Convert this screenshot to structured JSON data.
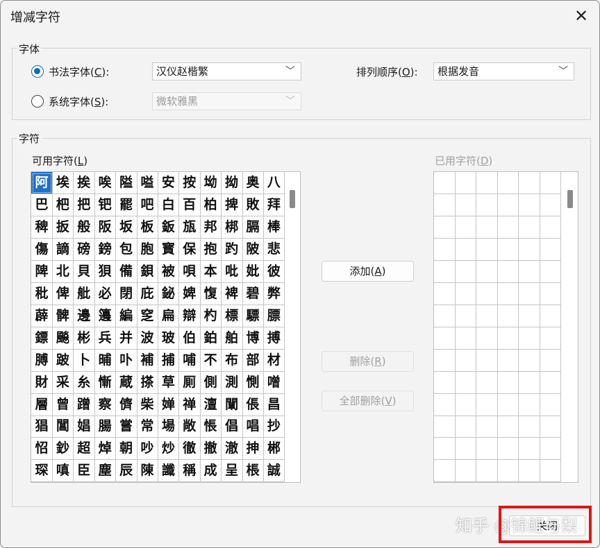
{
  "dialog": {
    "title": "增减字符",
    "close_glyph": "✕"
  },
  "font_group": {
    "label": "字体",
    "calligraphy": {
      "label": "书法字体(",
      "key": "C",
      "tail": "):",
      "selected": true,
      "value": "汉仪赵楷繁"
    },
    "system": {
      "label": "系统字体(",
      "key": "S",
      "tail": "):",
      "selected": false,
      "value": "微软雅黑"
    },
    "sort": {
      "label": "排列顺序(",
      "key": "O",
      "tail": "):",
      "value": "根据发音"
    }
  },
  "char_group": {
    "label": "字符",
    "available": {
      "label": "可用字符(",
      "key": "L",
      "tail": ")"
    },
    "used": {
      "label": "已用字符(",
      "key": "D",
      "tail": ")"
    },
    "rows": [
      [
        "阿",
        "埃",
        "挨",
        "唉",
        "隘",
        "嗌",
        "安",
        "按",
        "坳",
        "拗",
        "奥",
        "八"
      ],
      [
        "巴",
        "杷",
        "把",
        "钯",
        "罷",
        "吧",
        "白",
        "百",
        "柏",
        "捭",
        "敗",
        "拜"
      ],
      [
        "稗",
        "扳",
        "般",
        "阪",
        "坂",
        "板",
        "鈑",
        "瓬",
        "邦",
        "梆",
        "膈",
        "棒"
      ],
      [
        "傷",
        "謫",
        "磅",
        "鎊",
        "包",
        "胞",
        "寳",
        "保",
        "抱",
        "趵",
        "陂",
        "悲"
      ],
      [
        "陴",
        "北",
        "貝",
        "狽",
        "備",
        "鋇",
        "被",
        "唄",
        "本",
        "吡",
        "妣",
        "彼"
      ],
      [
        "秕",
        "俾",
        "舭",
        "必",
        "閉",
        "庇",
        "鉍",
        "婢",
        "愎",
        "裨",
        "碧",
        "弊"
      ],
      [
        "薜",
        "髀",
        "邊",
        "籩",
        "編",
        "窆",
        "扁",
        "辯",
        "杓",
        "標",
        "驃",
        "膘"
      ],
      [
        "鏢",
        "飈",
        "彬",
        "兵",
        "并",
        "波",
        "玻",
        "伯",
        "鉑",
        "舶",
        "博",
        "搏"
      ],
      [
        "膊",
        "跛",
        "卜",
        "晡",
        "卟",
        "補",
        "捕",
        "哺",
        "不",
        "布",
        "部",
        "材"
      ],
      [
        "財",
        "采",
        "糸",
        "慚",
        "蔵",
        "搽",
        "草",
        "厠",
        "側",
        "測",
        "惻",
        "噌"
      ],
      [
        "層",
        "曾",
        "蹭",
        "察",
        "儕",
        "柴",
        "婵",
        "禅",
        "澶",
        "闡",
        "倀",
        "昌"
      ],
      [
        "猖",
        "閶",
        "娼",
        "腸",
        "嘗",
        "常",
        "場",
        "敞",
        "悵",
        "倡",
        "唱",
        "抄"
      ],
      [
        "怊",
        "鈔",
        "超",
        "焯",
        "朝",
        "吵",
        "炒",
        "徹",
        "撤",
        "澈",
        "抻",
        "郴"
      ],
      [
        "琛",
        "嗔",
        "臣",
        "塵",
        "辰",
        "陳",
        "讖",
        "稱",
        "成",
        "呈",
        "棖",
        "誠"
      ]
    ],
    "add_button": {
      "label": "添加(",
      "key": "A",
      "tail": ")"
    },
    "delete_button": {
      "label": "删除(",
      "key": "R",
      "tail": ")"
    },
    "delete_all_button": {
      "label": "全部删除(",
      "key": "V",
      "tail": ")"
    }
  },
  "footer": {
    "close_button": "关闭",
    "watermark": "知乎 @锦鲤与梨"
  },
  "colors": {
    "selection": "#1f6fc4",
    "accent": "#0f6cbd",
    "highlight_box": "#e01515"
  }
}
